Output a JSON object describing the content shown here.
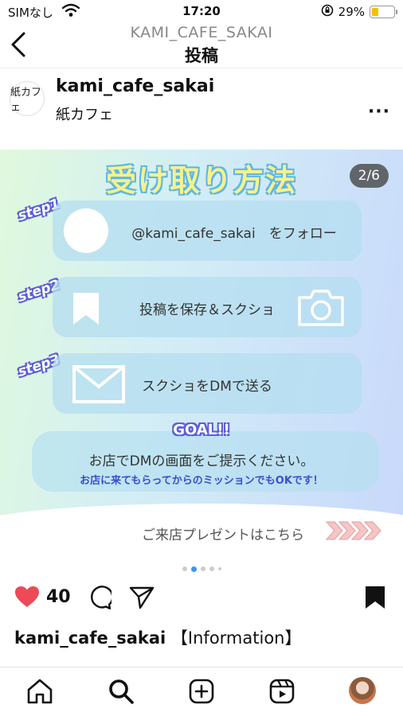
{
  "status_bar": {
    "carrier": "SIMなし",
    "time": "17:20",
    "battery_text": "29%",
    "battery_level": 0.29
  },
  "nav": {
    "account": "KAMI_CAFE_SAKAI",
    "title": "投稿"
  },
  "post": {
    "username": "kami_cafe_sakai",
    "location": "紙カフェ",
    "avatar_text": "紙カフェ"
  },
  "slide": {
    "headline": "受け取り方法",
    "counter": "2/6",
    "steps": [
      {
        "badge": "step1",
        "text": "@kami_cafe_sakai　をフォロー"
      },
      {
        "badge": "step2",
        "text": "投稿を保存＆スクショ"
      },
      {
        "badge": "step3",
        "text": "スクショをDMで送る"
      }
    ],
    "goal_label": "GOAL!!",
    "goal_text": "お店でDMの画面をご提示ください。",
    "goal_subtext": "お店に来てもらってからのミッションでもOKです！",
    "present_text": "ご来店プレゼントはこちら"
  },
  "carousel": {
    "total": 5,
    "active_index": 1
  },
  "actions": {
    "likes": "40",
    "liked": true
  },
  "caption": {
    "username": "kami_cafe_sakai",
    "text": "【Information】"
  },
  "colors": {
    "accent_blue": "#3897f0",
    "heart_red": "#ed4956",
    "step_purple": "#5a5fd6"
  },
  "tabs": [
    "home-icon",
    "search-icon",
    "create-icon",
    "reels-icon",
    "profile-avatar"
  ]
}
